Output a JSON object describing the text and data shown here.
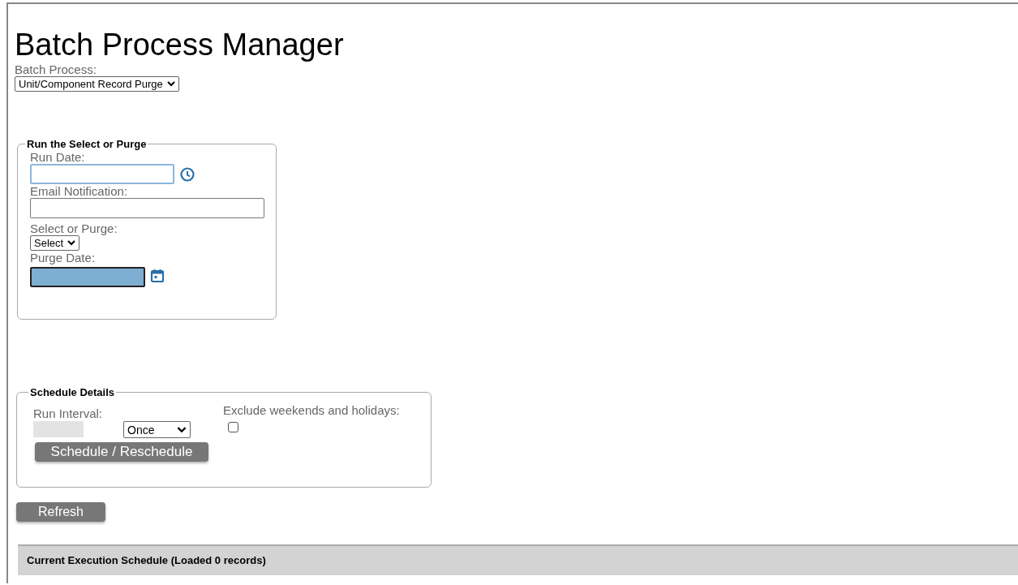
{
  "title": "Batch Process Manager",
  "batch_process": {
    "label": "Batch Process:",
    "value": "Unit/Component Record Purge"
  },
  "run_section": {
    "legend": "Run the Select or Purge",
    "run_date": {
      "label": "Run Date:",
      "focused": true
    },
    "email": {
      "label": "Email Notification:"
    },
    "select_or_purge": {
      "label": "Select or Purge:",
      "value": "Select"
    },
    "purge_date": {
      "label": "Purge Date:",
      "highlighted": true
    }
  },
  "schedule": {
    "legend": "Schedule Details",
    "run_interval_label": "Run Interval:",
    "interval_value": "Once",
    "exclude_label": "Exclude weekends and holidays:",
    "exclude_checked": false,
    "button": "Schedule / Reschedule"
  },
  "refresh_button": "Refresh",
  "execution_bar": "Current Execution Schedule (Loaded 0 records)"
}
